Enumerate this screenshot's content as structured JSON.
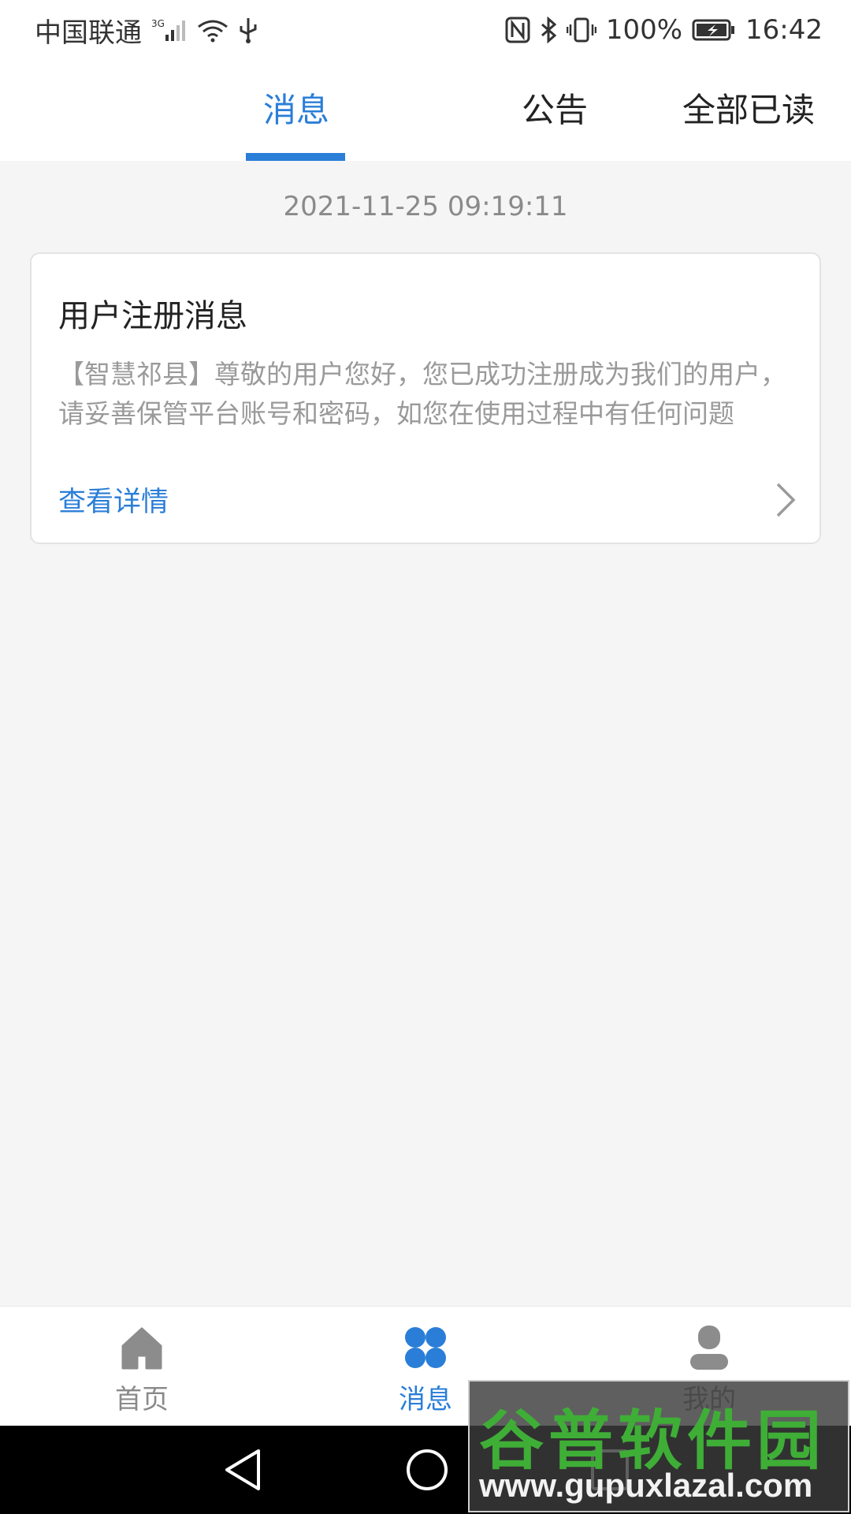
{
  "status_bar": {
    "carrier": "中国联通",
    "network": "3G",
    "battery": "100%",
    "time": "16:42"
  },
  "top_tabs": {
    "messages": "消息",
    "notices": "公告",
    "mark_all_read": "全部已读",
    "active": "messages"
  },
  "message": {
    "timestamp": "2021-11-25 09:19:11",
    "title": "用户注册消息",
    "body": "【智慧祁县】尊敬的用户您好，您已成功注册成为我们的用户，请妥善保管平台账号和密码，如您在使用过程中有任何问题",
    "detail_link": "查看详情"
  },
  "bottom_nav": {
    "items": [
      {
        "label": "首页",
        "icon": "home-icon"
      },
      {
        "label": "消息",
        "icon": "clover-icon"
      },
      {
        "label": "我的",
        "icon": "user-icon"
      }
    ],
    "active_index": 1
  },
  "watermark": {
    "title": "谷普软件园",
    "url": "www.gupuxlazal.com"
  },
  "colors": {
    "accent": "#2a7ed8",
    "background": "#f5f5f5"
  }
}
